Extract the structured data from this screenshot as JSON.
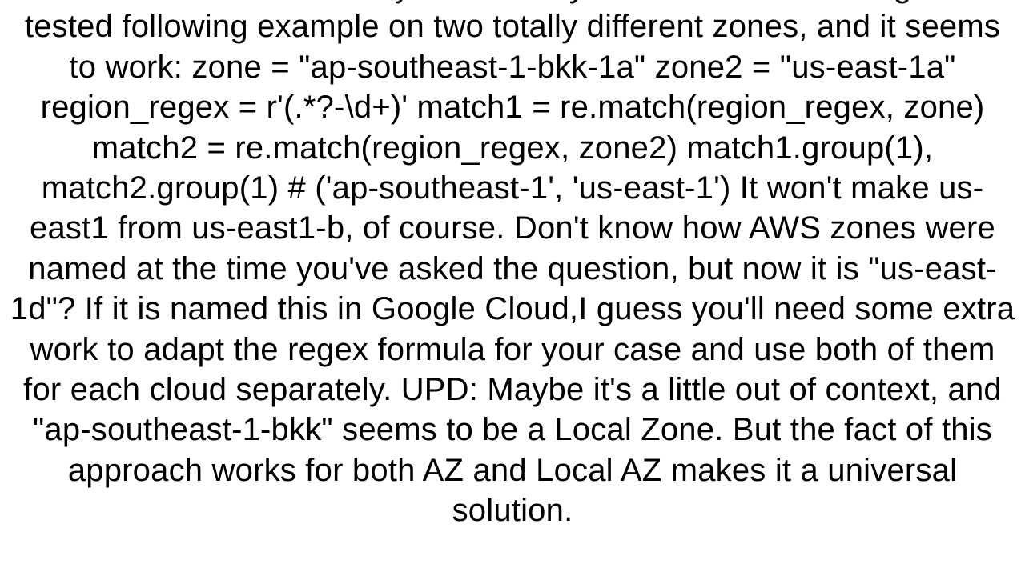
{
  "paragraph": "one more solution. The only correct way to do this is to use regex. I've tested following example on two totally different zones, and it seems to work: zone = \"ap-southeast-1-bkk-1a\" zone2 = \"us-east-1a\" region_regex = r'(.*?-\\d+)' match1 = re.match(region_regex, zone) match2 = re.match(region_regex, zone2) match1.group(1), match2.group(1) # ('ap-southeast-1', 'us-east-1')  It won't make us-east1 from us-east1-b, of course. Don't know how AWS zones were named at the time you've asked the question, but now it is \"us-east-1d\"? If it is named this  in Google Cloud,I guess you'll need some extra work to adapt the regex formula for your case and use both of them for each cloud separately. UPD: Maybe it's a little out of context, and \"ap-southeast-1-bkk\" seems to be a Local Zone. But the fact of this approach works for both AZ and Local AZ makes it a universal solution."
}
